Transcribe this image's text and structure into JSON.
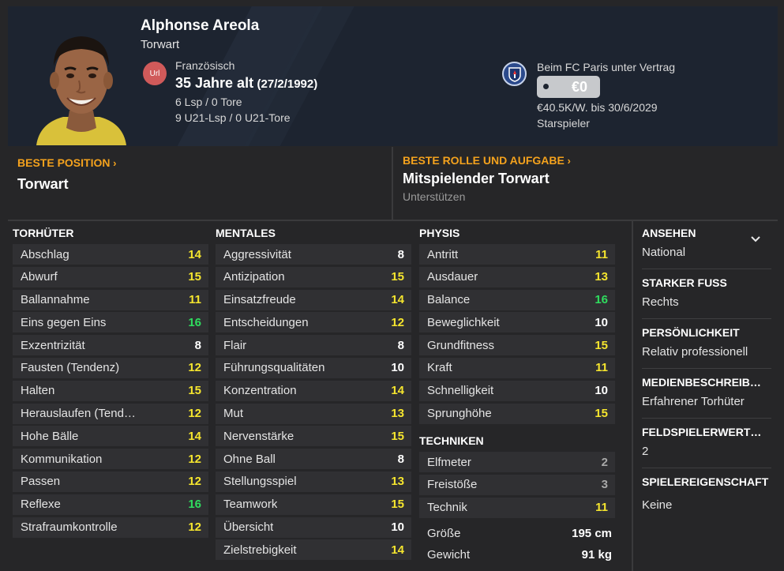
{
  "player": {
    "name": "Alphonse Areola",
    "position": "Torwart",
    "nationality": "Französisch",
    "flag_text": "Url",
    "age": "35 Jahre alt",
    "dob": "(27/2/1992)",
    "caps": "6 Lsp / 0 Tore",
    "u21_caps": "9 U21-Lsp / 0 U21-Tore"
  },
  "contract": {
    "status": "Beim FC Paris unter Vertrag",
    "value": "€0",
    "wage": "€40.5K/W. bis 30/6/2029",
    "squad_status": "Starspieler"
  },
  "best_position": {
    "label": "BESTE POSITION",
    "value": "Torwart"
  },
  "best_role": {
    "label": "BESTE ROLLE UND AUFGABE",
    "value": "Mitspielender Torwart",
    "duty": "Unterstützen"
  },
  "colors": {
    "green": "#2fdc5e",
    "yellow": "#f5e52e",
    "white": "#ffffff",
    "grey": "#a8a8a8",
    "accent": "#f4a21d"
  },
  "goalkeeping": {
    "title": "TORHÜTER",
    "items": [
      {
        "label": "Abschlag",
        "value": "14",
        "color": "#f5e52e"
      },
      {
        "label": "Abwurf",
        "value": "15",
        "color": "#f5e52e"
      },
      {
        "label": "Ballannahme",
        "value": "11",
        "color": "#f5e52e"
      },
      {
        "label": "Eins gegen Eins",
        "value": "16",
        "color": "#2fdc5e"
      },
      {
        "label": "Exzentrizität",
        "value": "8",
        "color": "#ffffff"
      },
      {
        "label": "Fausten (Tendenz)",
        "value": "12",
        "color": "#f5e52e"
      },
      {
        "label": "Halten",
        "value": "15",
        "color": "#f5e52e"
      },
      {
        "label": "Herauslaufen (Tend…",
        "value": "12",
        "color": "#f5e52e"
      },
      {
        "label": "Hohe Bälle",
        "value": "14",
        "color": "#f5e52e"
      },
      {
        "label": "Kommunikation",
        "value": "12",
        "color": "#f5e52e"
      },
      {
        "label": "Passen",
        "value": "12",
        "color": "#f5e52e"
      },
      {
        "label": "Reflexe",
        "value": "16",
        "color": "#2fdc5e"
      },
      {
        "label": "Strafraumkontrolle",
        "value": "12",
        "color": "#f5e52e"
      }
    ]
  },
  "mental": {
    "title": "MENTALES",
    "items": [
      {
        "label": "Aggressivität",
        "value": "8",
        "color": "#ffffff"
      },
      {
        "label": "Antizipation",
        "value": "15",
        "color": "#f5e52e"
      },
      {
        "label": "Einsatzfreude",
        "value": "14",
        "color": "#f5e52e"
      },
      {
        "label": "Entscheidungen",
        "value": "12",
        "color": "#f5e52e"
      },
      {
        "label": "Flair",
        "value": "8",
        "color": "#ffffff"
      },
      {
        "label": "Führungsqualitäten",
        "value": "10",
        "color": "#ffffff"
      },
      {
        "label": "Konzentration",
        "value": "14",
        "color": "#f5e52e"
      },
      {
        "label": "Mut",
        "value": "13",
        "color": "#f5e52e"
      },
      {
        "label": "Nervenstärke",
        "value": "15",
        "color": "#f5e52e"
      },
      {
        "label": "Ohne Ball",
        "value": "8",
        "color": "#ffffff"
      },
      {
        "label": "Stellungsspiel",
        "value": "13",
        "color": "#f5e52e"
      },
      {
        "label": "Teamwork",
        "value": "15",
        "color": "#f5e52e"
      },
      {
        "label": "Übersicht",
        "value": "10",
        "color": "#ffffff"
      },
      {
        "label": "Zielstrebigkeit",
        "value": "14",
        "color": "#f5e52e"
      }
    ]
  },
  "physical": {
    "title": "PHYSIS",
    "items": [
      {
        "label": "Antritt",
        "value": "11",
        "color": "#f5e52e"
      },
      {
        "label": "Ausdauer",
        "value": "13",
        "color": "#f5e52e"
      },
      {
        "label": "Balance",
        "value": "16",
        "color": "#2fdc5e"
      },
      {
        "label": "Beweglichkeit",
        "value": "10",
        "color": "#ffffff"
      },
      {
        "label": "Grundfitness",
        "value": "15",
        "color": "#f5e52e"
      },
      {
        "label": "Kraft",
        "value": "11",
        "color": "#f5e52e"
      },
      {
        "label": "Schnelligkeit",
        "value": "10",
        "color": "#ffffff"
      },
      {
        "label": "Sprunghöhe",
        "value": "15",
        "color": "#f5e52e"
      }
    ]
  },
  "technical": {
    "title": "TECHNIKEN",
    "items": [
      {
        "label": "Elfmeter",
        "value": "2",
        "color": "#a8a8a8"
      },
      {
        "label": "Freistöße",
        "value": "3",
        "color": "#a8a8a8"
      },
      {
        "label": "Technik",
        "value": "11",
        "color": "#f5e52e"
      }
    ]
  },
  "physique": {
    "height_label": "Größe",
    "height": "195 cm",
    "weight_label": "Gewicht",
    "weight": "91 kg"
  },
  "info": [
    {
      "title": "ANSEHEN",
      "value": "National"
    },
    {
      "title": "STARKER FUSS",
      "value": "Rechts"
    },
    {
      "title": "PERSÖNLICHKEIT",
      "value": "Relativ professionell"
    },
    {
      "title": "MEDIENBESCHREIB…",
      "value": "Erfahrener Torhüter"
    },
    {
      "title": "FELDSPIELERWERT…",
      "value": "2"
    },
    {
      "title": "SPIELEREIGENSCHAFT",
      "value": "Keine"
    }
  ]
}
